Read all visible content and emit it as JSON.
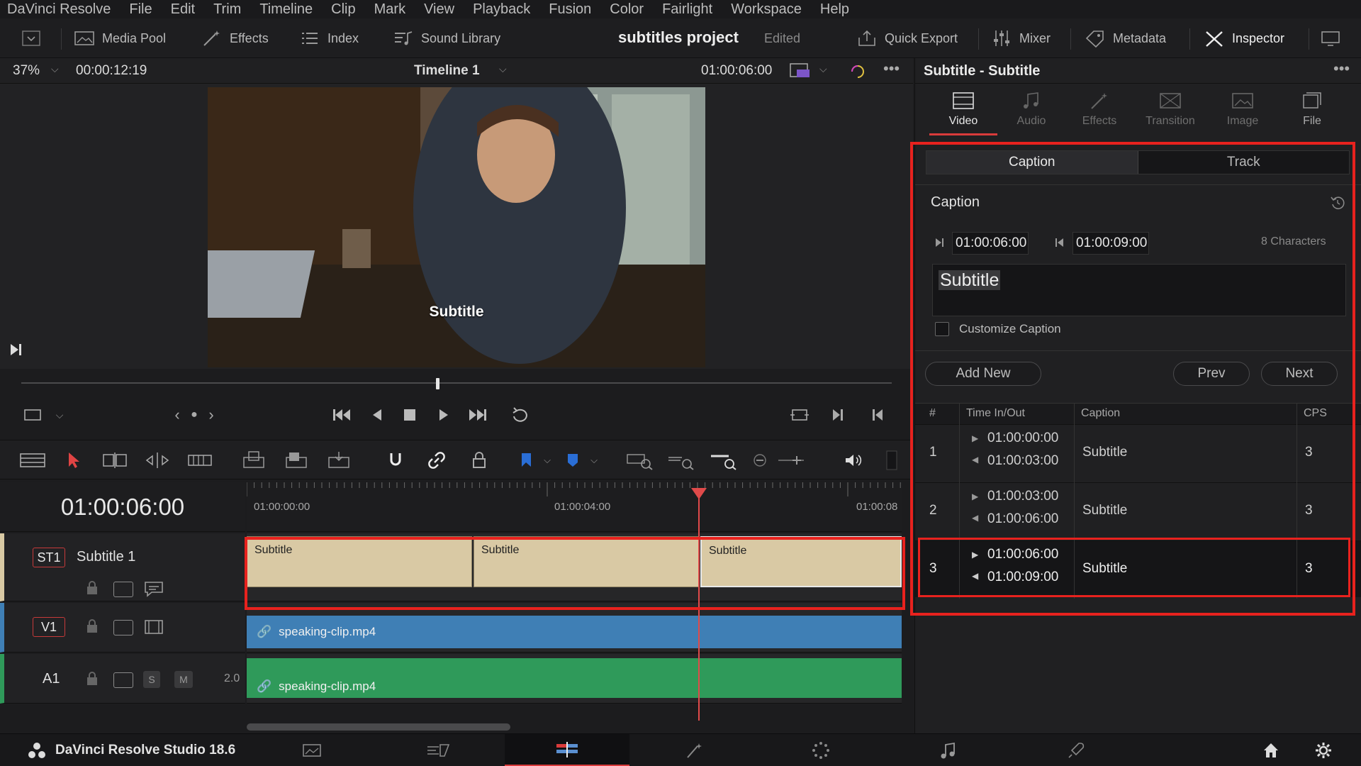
{
  "menu": [
    "DaVinci Resolve",
    "File",
    "Edit",
    "Trim",
    "Timeline",
    "Clip",
    "Mark",
    "View",
    "Playback",
    "Fusion",
    "Color",
    "Fairlight",
    "Workspace",
    "Help"
  ],
  "toolbar": {
    "media_pool": "Media Pool",
    "effects": "Effects",
    "index": "Index",
    "sound_library": "Sound Library",
    "project_title": "subtitles project",
    "project_status": "Edited",
    "quick_export": "Quick Export",
    "mixer": "Mixer",
    "metadata": "Metadata",
    "inspector": "Inspector"
  },
  "viewer": {
    "zoom": "37%",
    "source_timecode": "00:00:12:19",
    "timeline_name": "Timeline 1",
    "record_timecode": "01:00:06:00",
    "subtitle_overlay": "Subtitle"
  },
  "timeline": {
    "current_timecode": "01:00:06:00",
    "ruler": [
      "01:00:00:00",
      "01:00:04:00",
      "01:00:08"
    ],
    "tracks": {
      "st1": {
        "tag": "ST1",
        "name": "Subtitle 1",
        "clips": [
          "Subtitle",
          "Subtitle",
          "Subtitle"
        ]
      },
      "v1": {
        "tag": "V1",
        "clip": "speaking-clip.mp4"
      },
      "a1": {
        "tag": "A1",
        "level": "2.0",
        "solo": "S",
        "mute": "M",
        "clip": "speaking-clip.mp4"
      }
    }
  },
  "pagebar": {
    "app_name": "DaVinci Resolve Studio 18.6"
  },
  "inspector": {
    "title": "Subtitle - Subtitle",
    "tabs": [
      "Video",
      "Audio",
      "Effects",
      "Transition",
      "Image",
      "File"
    ],
    "segments": [
      "Caption",
      "Track"
    ],
    "section_title": "Caption",
    "time_in": "01:00:06:00",
    "time_out": "01:00:09:00",
    "char_count": "8 Characters",
    "caption_text": "Subtitle",
    "customize_label": "Customize Caption",
    "add_new": "Add New",
    "prev": "Prev",
    "next": "Next",
    "table": {
      "headers": [
        "#",
        "Time In/Out",
        "Caption",
        "CPS"
      ],
      "rows": [
        {
          "num": "1",
          "in": "01:00:00:00",
          "out": "01:00:03:00",
          "caption": "Subtitle",
          "cps": "3"
        },
        {
          "num": "2",
          "in": "01:00:03:00",
          "out": "01:00:06:00",
          "caption": "Subtitle",
          "cps": "3"
        },
        {
          "num": "3",
          "in": "01:00:06:00",
          "out": "01:00:09:00",
          "caption": "Subtitle",
          "cps": "3"
        }
      ]
    }
  },
  "colors": {
    "accent_red": "#e8221e",
    "subtitle_clip": "#d9c9a4",
    "video_clip": "#3f7fb5",
    "audio_clip": "#2f9a5a"
  }
}
